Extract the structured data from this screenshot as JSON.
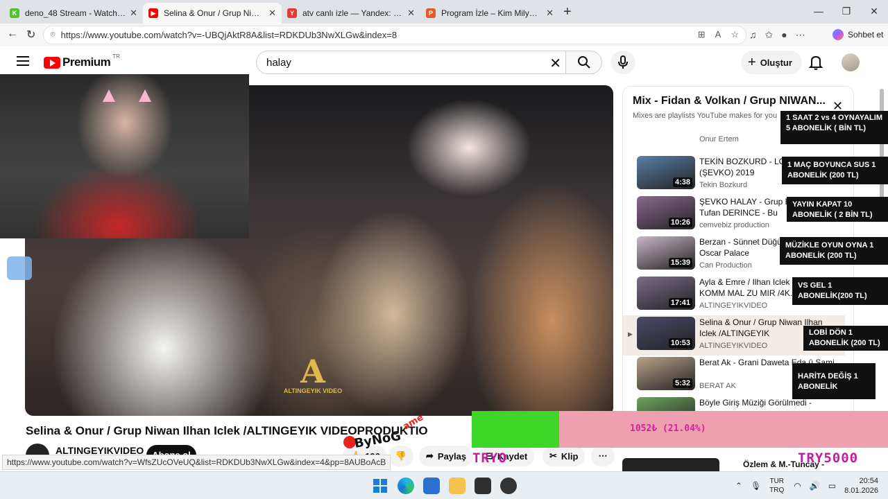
{
  "browser": {
    "tabs": [
      {
        "title": "deno_48 Stream - Watch Live on K",
        "color": "#53c22b",
        "glyph": "K",
        "active": false
      },
      {
        "title": "Selina & Onur / Grup Niwan Ilhan",
        "color": "#ff0000",
        "glyph": "▶",
        "active": true
      },
      {
        "title": "atv canlı izle — Yandex: 546 bin so",
        "color": "#e53935",
        "glyph": "Y",
        "active": false
      },
      {
        "title": "Program İzle – Kim Milyoner Olma",
        "color": "#e55a2b",
        "glyph": "P",
        "active": false
      }
    ],
    "url": "https://www.youtube.com/watch?v=-UBQjAktR8A&list=RDKDUb3NwXLGw&index=8",
    "copilot_label": "Sohbet et",
    "status_url": "https://www.youtube.com/watch?v=WfsZUcOVeUQ&list=RDKDUb3NwXLGw&index=4&pp=8AUBoAcB"
  },
  "youtube": {
    "logo_text": "Premium",
    "country": "TR",
    "search_value": "halay",
    "create_label": "Oluştur",
    "video_title": "Selina & Onur / Grup Niwan Ilhan Iclek /ALTINGEYIK VIDEOPRODUKTIO",
    "watermark": "ALTINGEYIK VIDEO",
    "channel_name": "ALTINGEYIKVIDEO",
    "subscribe_label": "Abone ol",
    "like_count": "196",
    "share_label": "Paylaş",
    "save_label": "Kaydet",
    "clip_label": "Klip",
    "next_item_title": "Özlem & M.-Tuncay -"
  },
  "playlist": {
    "title": "Mix - Fidan & Volkan / Grup NIWAN...",
    "subtitle": "Mixes are playlists YouTube makes for you",
    "partial_top_channel": "Onur Ertem",
    "items": [
      {
        "title": "TEKİN BOZKURD - LORKE (ŞEVKO) 2019",
        "channel": "Tekin Bozkurd",
        "duration": "4:38",
        "current": false,
        "thumb": "#5a7fa8"
      },
      {
        "title": "ŞEVKO HALAY - Grup EVİN feat. Tufan DERINCE - Bu",
        "channel": "cemvebiz production",
        "duration": "10:26",
        "current": false,
        "thumb": "#8a6a8e"
      },
      {
        "title": "Berzan - Sünnet Düğünü - YÖREM - Oscar Palace",
        "channel": "Can Production",
        "duration": "15:39",
        "current": false,
        "thumb": "#c9b6c7"
      },
      {
        "title": "Ayla & Emre / Ilhan Iclek LIVE KOMM MAL ZU MIR /4K...",
        "channel": "ALTINGEYIKVIDEO",
        "duration": "17:41",
        "current": false,
        "thumb": "#7b6d8a"
      },
      {
        "title": "Selina & Onur / Grup Niwan Ilhan Iclek /ALTINGEYIK",
        "channel": "ALTINGEYIKVIDEO",
        "duration": "10:53",
        "current": true,
        "thumb": "#4a4a6a"
      },
      {
        "title": "Berat Ak - Grani Daweta Eda û Sami",
        "channel": "BERAT AK",
        "duration": "5:32",
        "current": false,
        "thumb": "#b8a28a"
      },
      {
        "title": "Böyle Giriş Müziği Görülmedi -",
        "channel": "",
        "duration": "",
        "current": false,
        "thumb": "#6da35c"
      }
    ]
  },
  "overlay": {
    "rules": [
      "1 SAAT 2 vs 4 OYNAYALIM 5 ABONELİK ( BİN TL)",
      "1 MAÇ BOYUNCA SUS 1 ABONELİK (200 TL)",
      "YAYIN KAPAT 10 ABONELİK ( 2 BİN TL)",
      "MÜZİKLE OYUN OYNA 1 ABONELİK (200 TL)",
      "VS GEL 1 ABONELİK(200 TL)",
      "LOBİ DÖN 1 ABONELİK (200 TL)",
      "HARİTA DEĞİŞ 1 ABONELİK"
    ],
    "goal_text": "1052₺ (21.04%)",
    "goal_fraction": 0.2104,
    "ticker_left": "TRYO",
    "ticker_right": "TRY5000",
    "brand": "ByNoG",
    "brand_sup": "ame"
  },
  "taskbar": {
    "lang_top": "TUR",
    "lang_bottom": "TRQ",
    "time": "20:54",
    "date": "8.01.2026"
  }
}
